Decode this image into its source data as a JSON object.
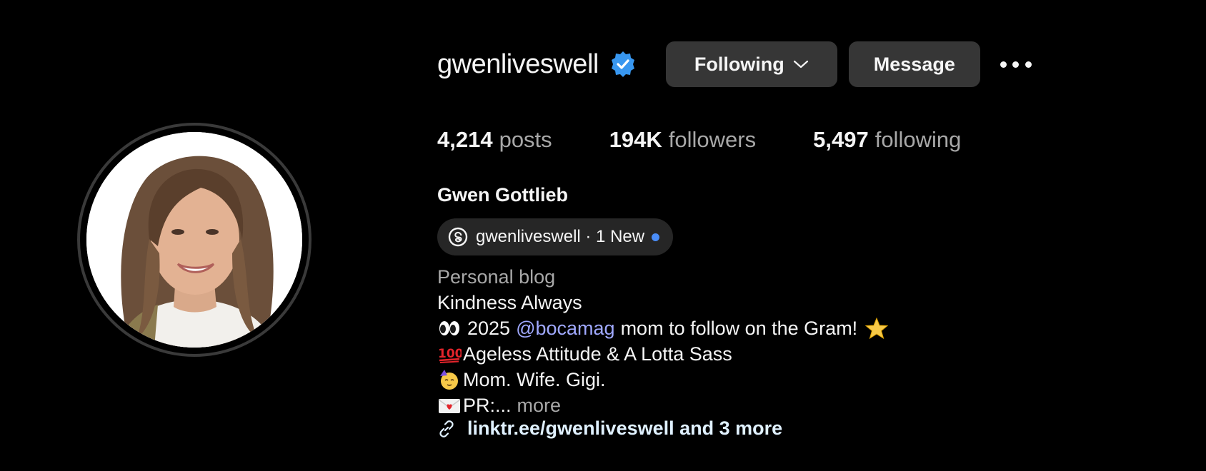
{
  "profile": {
    "username": "gwenliveswell",
    "verified_icon": "verified-badge-icon",
    "full_name": "Gwen Gottlieb"
  },
  "actions": {
    "following_label": "Following",
    "message_label": "Message",
    "more_icon": "more-horizontal-icon"
  },
  "stats": [
    {
      "value": "4,214",
      "label": "posts"
    },
    {
      "value": "194K",
      "label": "followers"
    },
    {
      "value": "5,497",
      "label": "following"
    }
  ],
  "threads": {
    "icon": "threads-icon",
    "text": "gwenliveswell · 1 New"
  },
  "bio": {
    "category": "Personal blog",
    "line1": "Kindness Always",
    "line2_pre": "2025",
    "line2_mention": "@bocamag",
    "line2_post": "mom to follow on the Gram!",
    "line3": "Ageless Attitude & A Lotta Sass",
    "line4": "Mom. Wife. Gigi.",
    "line5": "PR:...",
    "more": "more"
  },
  "link": {
    "icon": "link-icon",
    "text": "linktr.ee/gwenliveswell and 3 more"
  },
  "colors": {
    "background": "#000000",
    "button_bg": "#363636",
    "verified": "#3897f0",
    "mention": "#a0a9ff",
    "link": "#e0f1ff",
    "secondary_text": "#a8a8a8"
  }
}
